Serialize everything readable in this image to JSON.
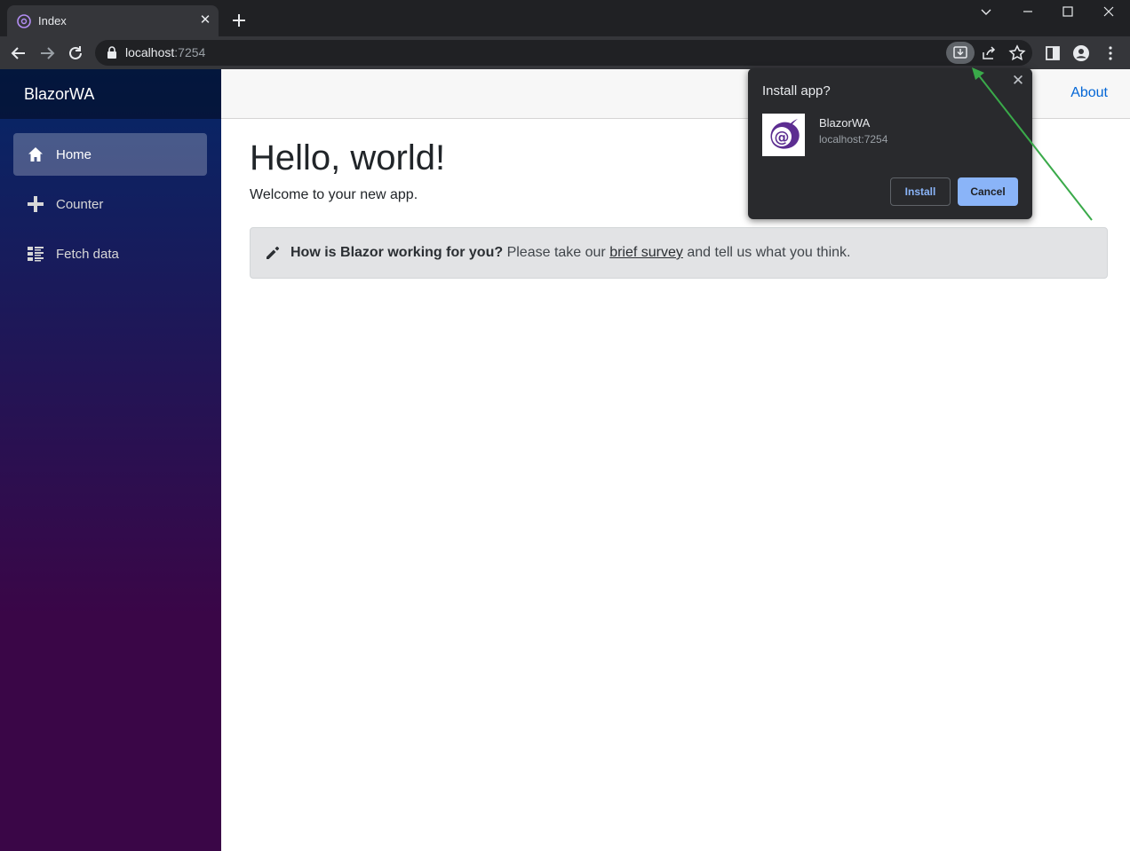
{
  "browser": {
    "tab_title": "Index",
    "url_host": "localhost",
    "url_port": ":7254"
  },
  "sidebar": {
    "brand": "BlazorWA",
    "items": [
      {
        "label": "Home",
        "icon": "home-icon"
      },
      {
        "label": "Counter",
        "icon": "plus-icon"
      },
      {
        "label": "Fetch data",
        "icon": "list-icon"
      }
    ]
  },
  "topbar": {
    "about": "About"
  },
  "main": {
    "heading": "Hello, world!",
    "welcome": "Welcome to your new app.",
    "survey": {
      "bold": "How is Blazor working for you?",
      "before_link": " Please take our ",
      "link": "brief survey",
      "after_link": " and tell us what you think."
    }
  },
  "install_bubble": {
    "title": "Install app?",
    "app_name": "BlazorWA",
    "app_origin": "localhost:7254",
    "install_label": "Install",
    "cancel_label": "Cancel"
  },
  "colors": {
    "annotation_arrow": "#3aaa4a",
    "link": "#0366d6",
    "accent": "#8ab4f8"
  }
}
